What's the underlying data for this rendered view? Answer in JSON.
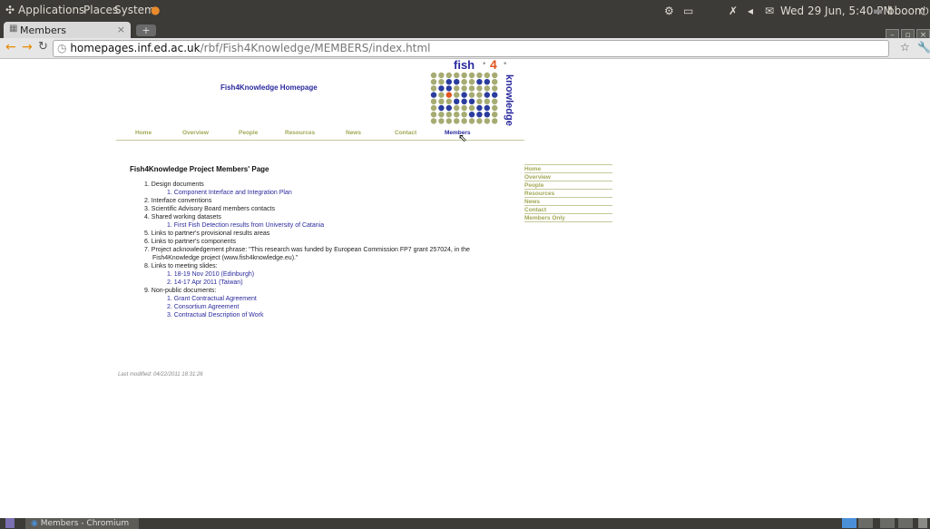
{
  "panel": {
    "menus": [
      "Applications",
      "Places",
      "System"
    ],
    "clock": "Wed 29 Jun,  5:40 PM",
    "user": "bboom"
  },
  "browser": {
    "tab_title": "Members",
    "url_host": "homepages.inf.ed.ac.uk",
    "url_path": "/rbf/Fish4Knowledge/MEMBERS/index.html",
    "taskbar_item": "Members - Chromium"
  },
  "site": {
    "header_title": "Fish4Knowledge Homepage",
    "logo": {
      "word1": "fish",
      "sep": "•",
      "num": "4",
      "word2": "knowledge"
    },
    "nav": [
      "Home",
      "Overview",
      "People",
      "Resources",
      "News",
      "Contact",
      "Members"
    ],
    "sidebar": [
      "Home",
      "Overview",
      "People",
      "Resources",
      "News",
      "Contact",
      "Members Only"
    ],
    "page_heading": "Fish4Knowledge Project Members' Page",
    "items": {
      "i1": "1. Design documents",
      "i1a": "1. Component Interface and Integration Plan",
      "i2": "2. Interface conventions",
      "i3": "3. Scientific Advisory Board members contacts",
      "i4": "4. Shared working datasets",
      "i4a": "1. First Fish Detection results from University of Catania",
      "i5": "5. Links to partner's provisional results areas",
      "i6": "6. Links to partner's components",
      "i7a": "7. Project acknowledgement phrase: \"This research was funded by European Commission FP7 grant 257024, in the",
      "i7b": "Fish4Knowledge project (www.fish4knowledge.eu).\"",
      "i8": "8. Links to meeting slides:",
      "i8a": "1. 18-19 Nov 2010 (Edinburgh)",
      "i8b": "2. 14-17 Apr 2011 (Taiwan)",
      "i9": "9. Non-public documents:",
      "i9a": "1. Grant Contractual Agreement",
      "i9b": "2. Consortium Agreement",
      "i9c": "3. Contractual Description of Work"
    },
    "last_modified": "Last modified: 04/22/2011 18:31:26"
  },
  "colors": {
    "panel": "#3c3b37",
    "nav": "#a2a855",
    "link": "#2a2a9e"
  }
}
